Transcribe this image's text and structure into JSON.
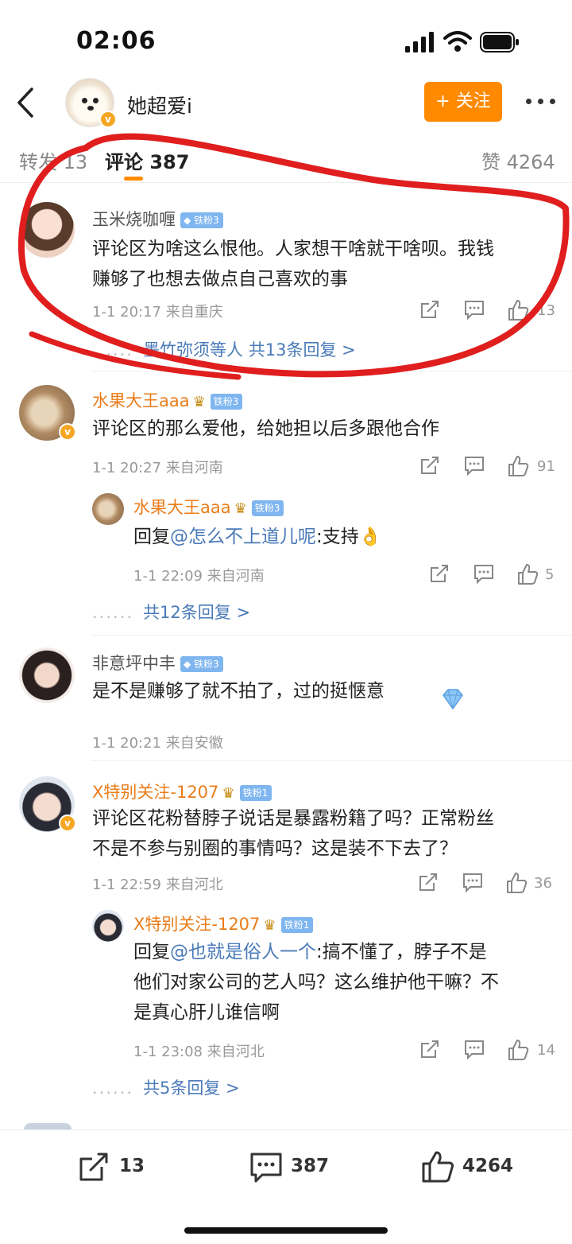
{
  "status": {
    "time": "02:06"
  },
  "header": {
    "name": "她超爱i",
    "follow_label": "+ 关注"
  },
  "tabs": {
    "repost": "转发 13",
    "comments": "评论 387",
    "likes": "赞 4264"
  },
  "comments": [
    {
      "user": "玉米烧咖喱",
      "badge": "铁粉3",
      "text_line1": "评论区为啥这么恨他。人家想干啥就干啥呗。我钱",
      "text_line2": "赚够了也想去做点自己喜欢的事",
      "meta": "1-1 20:17 来自重庆",
      "likes": "13",
      "replies": "墨竹弥须等人  共13条回复 >"
    },
    {
      "user": "水果大王aaa",
      "badge": "铁粉3",
      "text": "评论区的那么爱他，给她担以后多跟他合作",
      "meta": "1-1 20:27 来自河南",
      "likes": "91",
      "reply": {
        "user": "水果大王aaa",
        "badge": "铁粉3",
        "prefix": "回复",
        "at": "@怎么不上道儿呢",
        "text": ":支持👌",
        "meta": "1-1 22:09 来自河南",
        "likes": "5"
      },
      "replies": "共12条回复 >"
    },
    {
      "user": "非意坪中丰",
      "badge": "铁粉3",
      "text": "是不是赚够了就不拍了，过的挺惬意",
      "meta": "1-1 20:21 来自安徽"
    },
    {
      "user": "X特别关注-1207",
      "badge": "铁粉1",
      "text_line1": "评论区花粉替脖子说话是暴露粉籍了吗？正常粉丝",
      "text_line2": "不是不参与别圈的事情吗？这是装不下去了？",
      "meta": "1-1 22:59 来自河北",
      "likes": "36",
      "reply": {
        "user": "X特别关注-1207",
        "badge": "铁粉1",
        "prefix": "回复",
        "at": "@也就是俗人一个",
        "text_line1": ":搞不懂了，脖子不是",
        "text_line2": "他们对家公司的艺人吗？这么维护他干嘛？不",
        "text_line3": "是真心肝儿谁信啊",
        "meta": "1-1 23:08 来自河北",
        "likes": "14"
      },
      "replies": "共5条回复 >"
    }
  ],
  "bottom": {
    "repost": "13",
    "comments": "387",
    "likes": "4264"
  },
  "colors": {
    "accent": "#ff8a00",
    "link": "#4a7ab8",
    "annotation": "#e01e1e"
  }
}
